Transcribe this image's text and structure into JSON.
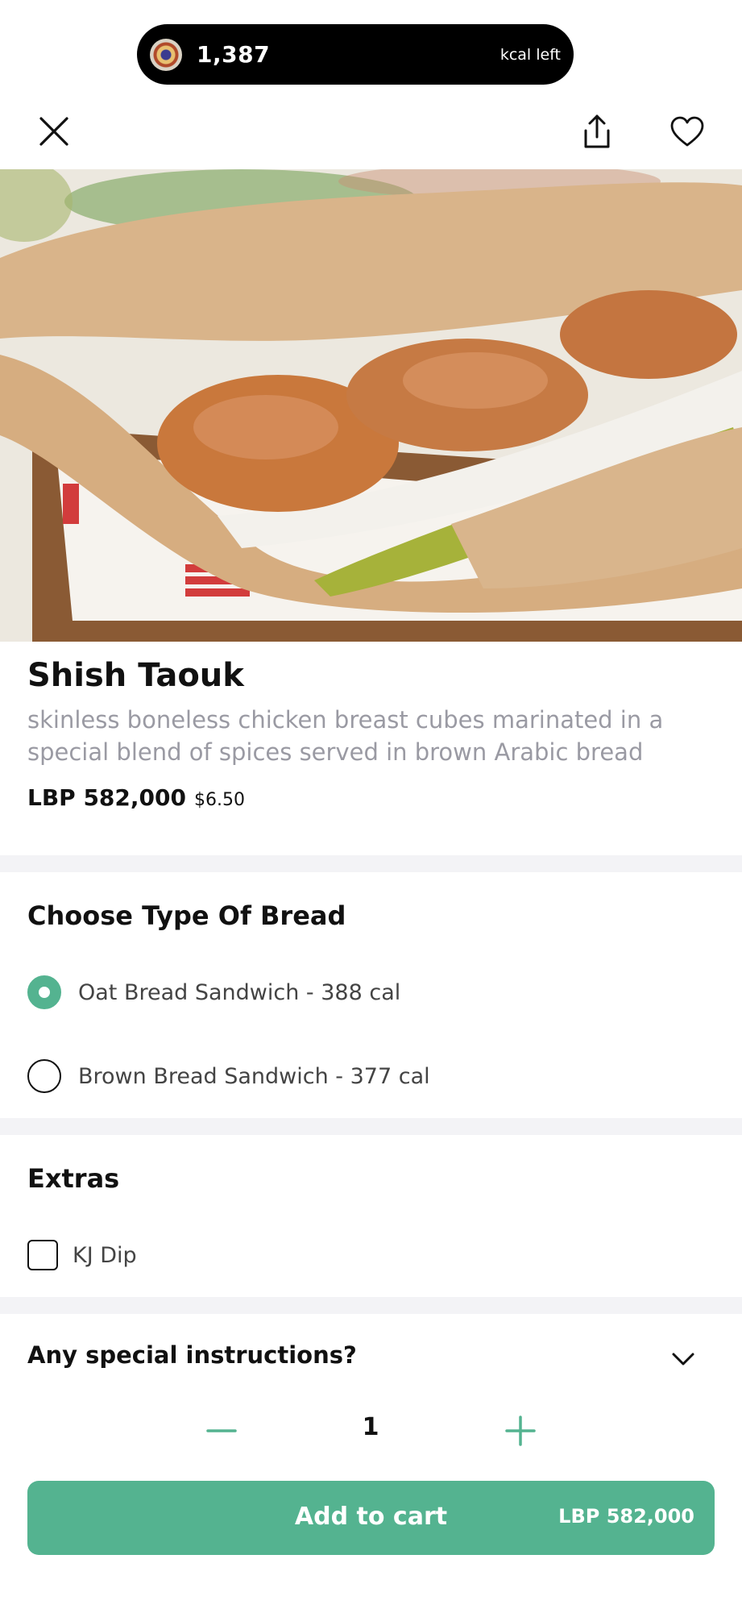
{
  "status_pill": {
    "kcal_value": "1,387",
    "kcal_label": "kcal left"
  },
  "header": {
    "close_icon": "close-icon",
    "share_icon": "share-icon",
    "favorite_icon": "heart-icon"
  },
  "product": {
    "name": "Shish Taouk",
    "description": "skinless boneless chicken breast cubes marinated in a special blend of spices served in brown Arabic bread",
    "price_lbp": "LBP 582,000",
    "price_usd": "$6.50"
  },
  "bread_section": {
    "title": "Choose Type Of Bread",
    "options": [
      {
        "label": "Oat Bread Sandwich - 388 cal",
        "selected": true
      },
      {
        "label": "Brown Bread Sandwich - 377 cal",
        "selected": false
      }
    ]
  },
  "extras_section": {
    "title": "Extras",
    "options": [
      {
        "label": "KJ Dip",
        "checked": false
      }
    ]
  },
  "instructions": {
    "label": "Any special instructions?"
  },
  "quantity": {
    "value": "1"
  },
  "cart_button": {
    "label": "Add to cart",
    "price": "LBP 582,000"
  },
  "colors": {
    "accent": "#54b390",
    "pill_bg": "#000000",
    "muted_text": "#9a9aa3",
    "separator": "#f3f3f6"
  }
}
